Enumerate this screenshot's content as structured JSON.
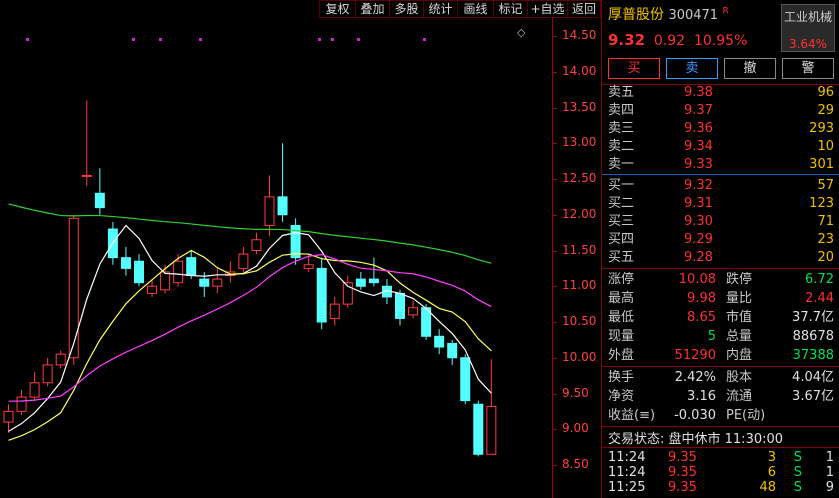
{
  "toolbar": [
    "复权",
    "叠加",
    "多股",
    "统计",
    "画线",
    "标记",
    "+自选",
    "返回"
  ],
  "y_ticks": [
    "14.50",
    "14.00",
    "13.50",
    "13.00",
    "12.50",
    "12.00",
    "11.50",
    "11.00",
    "10.50",
    "10.00",
    "9.50",
    "9.00",
    "8.50"
  ],
  "chart_data": {
    "type": "candlestick",
    "candles": [
      [
        9.1,
        9.25,
        8.95,
        9.35
      ],
      [
        9.25,
        9.45,
        9.2,
        9.55
      ],
      [
        9.45,
        9.65,
        9.4,
        9.8
      ],
      [
        9.65,
        9.9,
        9.6,
        10.0
      ],
      [
        9.9,
        10.05,
        9.85,
        10.1
      ],
      [
        10.0,
        11.95,
        9.9,
        12.0
      ],
      [
        12.55,
        12.55,
        12.4,
        13.6
      ],
      [
        12.3,
        12.1,
        12.0,
        12.65
      ],
      [
        11.8,
        11.4,
        11.3,
        11.9
      ],
      [
        11.4,
        11.25,
        11.15,
        11.55
      ],
      [
        11.35,
        11.05,
        11.0,
        11.45
      ],
      [
        10.9,
        11.0,
        10.85,
        11.1
      ],
      [
        10.95,
        11.2,
        10.9,
        11.3
      ],
      [
        11.05,
        11.35,
        11.0,
        11.45
      ],
      [
        11.4,
        11.15,
        11.1,
        11.5
      ],
      [
        11.1,
        11.0,
        10.85,
        11.2
      ],
      [
        11.0,
        11.1,
        10.9,
        11.25
      ],
      [
        11.15,
        11.2,
        11.05,
        11.35
      ],
      [
        11.25,
        11.45,
        11.2,
        11.55
      ],
      [
        11.5,
        11.65,
        11.45,
        11.75
      ],
      [
        11.85,
        12.25,
        11.7,
        12.55
      ],
      [
        12.25,
        12.0,
        11.9,
        13.0
      ],
      [
        11.85,
        11.4,
        11.3,
        11.95
      ],
      [
        11.25,
        11.3,
        11.2,
        11.45
      ],
      [
        11.25,
        10.5,
        10.4,
        11.4
      ],
      [
        10.55,
        10.75,
        10.45,
        10.85
      ],
      [
        10.75,
        11.05,
        10.7,
        11.15
      ],
      [
        11.1,
        11.0,
        10.95,
        11.2
      ],
      [
        11.1,
        11.05,
        11.0,
        11.4
      ],
      [
        11.0,
        10.85,
        10.75,
        11.1
      ],
      [
        10.9,
        10.55,
        10.45,
        10.95
      ],
      [
        10.6,
        10.7,
        10.55,
        10.8
      ],
      [
        10.7,
        10.3,
        10.25,
        10.75
      ],
      [
        10.3,
        10.15,
        10.05,
        10.4
      ],
      [
        10.2,
        10.0,
        9.9,
        10.25
      ],
      [
        10.0,
        9.4,
        9.35,
        10.05
      ],
      [
        9.35,
        8.65,
        8.62,
        9.4
      ],
      [
        8.65,
        9.32,
        8.65,
        9.98
      ]
    ],
    "ylim": [
      8.2,
      14.6
    ]
  },
  "stock": {
    "name": "厚普股份",
    "code": "300471",
    "r_mark": "R",
    "price": "9.32",
    "change": "0.92",
    "change_pct": "10.95%",
    "industry": "工业机械",
    "industry_pct": "3.64%"
  },
  "buttons": {
    "buy": "买",
    "sell": "卖",
    "cancel": "撤",
    "warn": "警"
  },
  "asks": [
    {
      "label": "卖五",
      "price": "9.38",
      "vol": "96"
    },
    {
      "label": "卖四",
      "price": "9.37",
      "vol": "29"
    },
    {
      "label": "卖三",
      "price": "9.36",
      "vol": "293"
    },
    {
      "label": "卖二",
      "price": "9.34",
      "vol": "10"
    },
    {
      "label": "卖一",
      "price": "9.33",
      "vol": "301"
    }
  ],
  "bids": [
    {
      "label": "买一",
      "price": "9.32",
      "vol": "57"
    },
    {
      "label": "买二",
      "price": "9.31",
      "vol": "123"
    },
    {
      "label": "买三",
      "price": "9.30",
      "vol": "71"
    },
    {
      "label": "买四",
      "price": "9.29",
      "vol": "23"
    },
    {
      "label": "买五",
      "price": "9.28",
      "vol": "20"
    }
  ],
  "stats1": [
    {
      "k": "涨停",
      "v": "10.08",
      "vc": "red",
      "k2": "跌停",
      "v2": "6.72",
      "v2c": "green"
    },
    {
      "k": "最高",
      "v": "9.98",
      "vc": "red",
      "k2": "量比",
      "v2": "2.44",
      "v2c": "red"
    },
    {
      "k": "最低",
      "v": "8.65",
      "vc": "red",
      "k2": "市值",
      "v2": "37.7亿",
      "v2c": "white"
    },
    {
      "k": "现量",
      "v": "5",
      "vc": "green",
      "k2": "总量",
      "v2": "88678",
      "v2c": "white"
    },
    {
      "k": "外盘",
      "v": "51290",
      "vc": "red",
      "k2": "内盘",
      "v2": "37388",
      "v2c": "green"
    }
  ],
  "stats2": [
    {
      "k": "换手",
      "v": "2.42%",
      "vc": "white",
      "k2": "股本",
      "v2": "4.04亿",
      "v2c": "white"
    },
    {
      "k": "净资",
      "v": "3.16",
      "vc": "white",
      "k2": "流通",
      "v2": "3.67亿",
      "v2c": "white"
    },
    {
      "k": "收益(≡)",
      "v": "-0.030",
      "vc": "white",
      "k2": "PE(动)",
      "v2": "",
      "v2c": "white"
    }
  ],
  "trade_status": "交易状态: 盘中休市 11:30:00",
  "ticks": [
    {
      "t": "11:24",
      "p": "9.35",
      "q": "3",
      "bs": "S",
      "n": "1"
    },
    {
      "t": "11:24",
      "p": "9.35",
      "q": "6",
      "bs": "S",
      "n": "1"
    },
    {
      "t": "11:25",
      "p": "9.35",
      "q": "48",
      "bs": "S",
      "n": "9"
    }
  ]
}
